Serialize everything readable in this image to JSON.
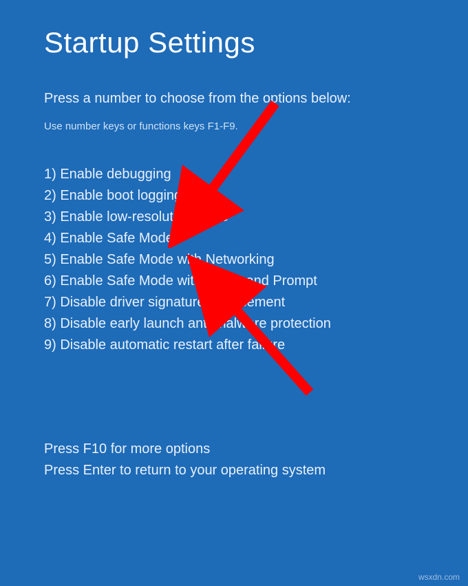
{
  "title": "Startup Settings",
  "subtitle": "Press a number to choose from the options below:",
  "hint": "Use number keys or functions keys F1-F9.",
  "options": [
    "1) Enable debugging",
    "2) Enable boot logging",
    "3) Enable low-resolution video",
    "4) Enable Safe Mode",
    "5) Enable Safe Mode with Networking",
    "6) Enable Safe Mode with Command Prompt",
    "7) Disable driver signature enforcement",
    "8) Disable early launch anti-malware protection",
    "9) Disable automatic restart after failure"
  ],
  "footer": {
    "line1": "Press F10 for more options",
    "line2": "Press Enter to return to your operating system"
  },
  "watermark": "wsxdn.com",
  "annotation": {
    "arrows": [
      {
        "target_option_index": 3
      },
      {
        "target_option_index": 4
      }
    ],
    "color": "#ff0000"
  }
}
